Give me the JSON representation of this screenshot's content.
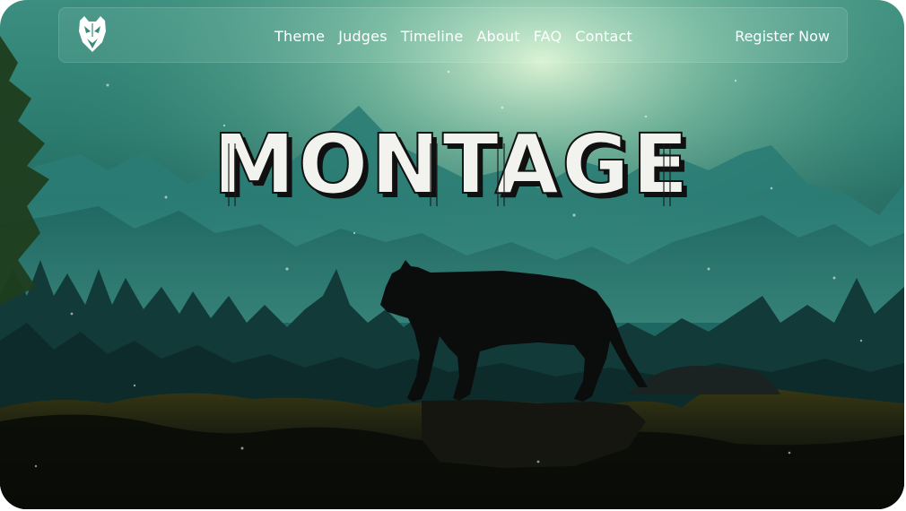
{
  "nav": {
    "logo_icon": "panther-head-logo-icon",
    "links": [
      {
        "label": "Theme"
      },
      {
        "label": "Judges"
      },
      {
        "label": "Timeline"
      },
      {
        "label": "About"
      },
      {
        "label": "FAQ"
      },
      {
        "label": "Contact"
      }
    ],
    "cta_label": "Register Now"
  },
  "hero": {
    "title": "MONTAGE"
  },
  "colors": {
    "sky_glow": "#d8f5d8",
    "mountain_teal": "#2f8a80",
    "forest_dark": "#0d2b2a",
    "panther": "#0b0d0d",
    "title_fill": "#f2f2ee"
  }
}
